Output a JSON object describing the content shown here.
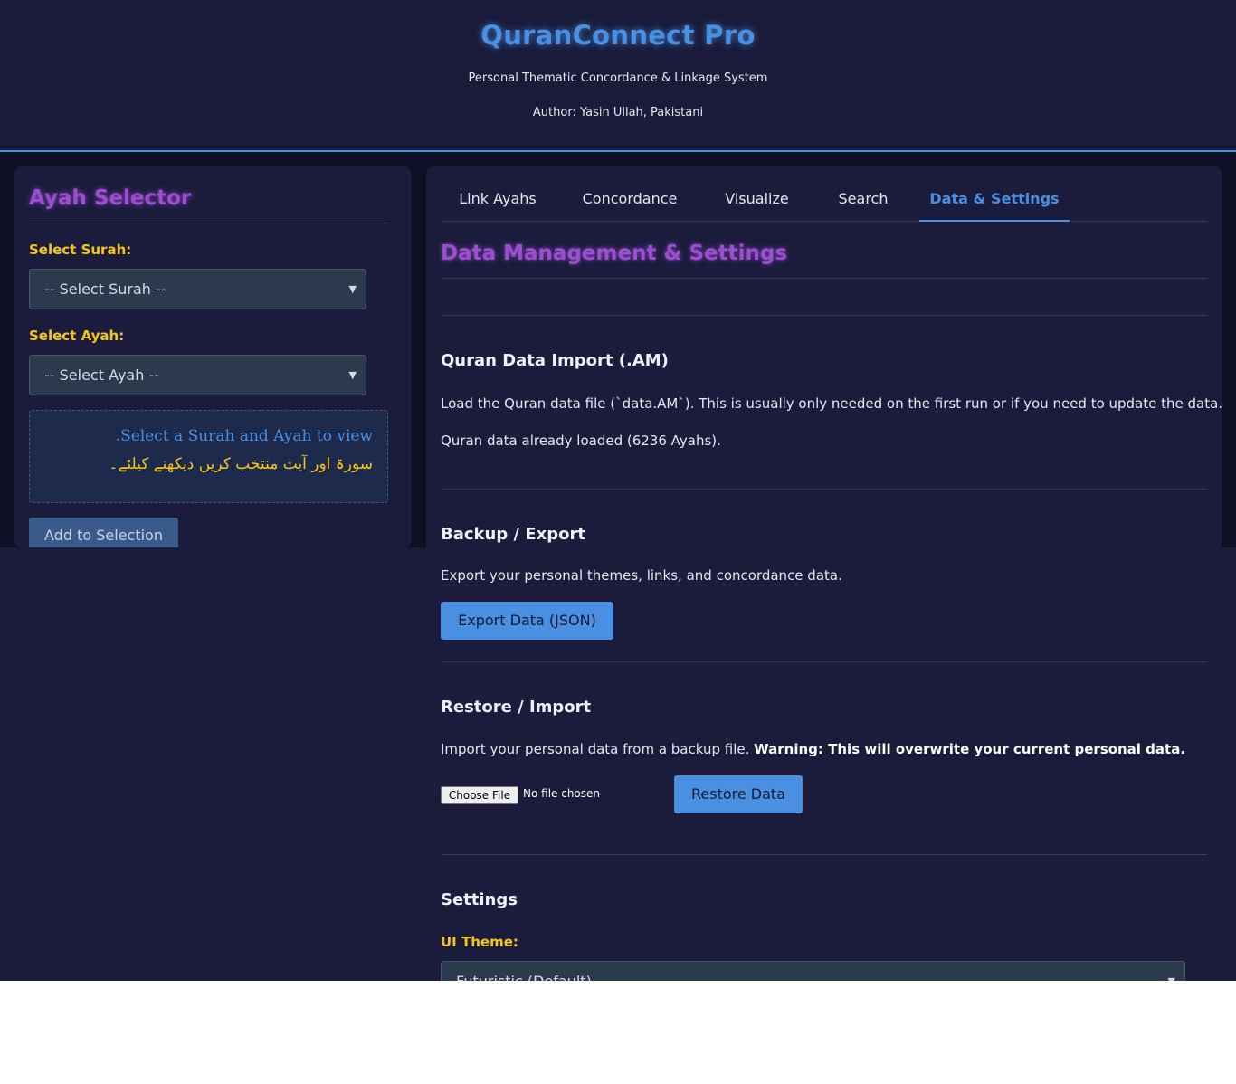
{
  "header": {
    "title": "QuranConnect Pro",
    "subtitle": "Personal Thematic Concordance & Linkage System",
    "author": "Author: Yasin Ullah, Pakistani"
  },
  "ayah_selector": {
    "heading": "Ayah Selector",
    "surah_label": "Select Surah:",
    "surah_selected": "-- Select Surah --",
    "ayah_label": "Select Ayah:",
    "ayah_selected": "-- Select Ayah --",
    "info_en": ".Select a Surah and Ayah to view",
    "info_ur": "سورۃ اور آیت منتخب کریں دیکھنے کیلئے۔",
    "add_button": "Add to Selection"
  },
  "tabs": [
    {
      "label": "Link Ayahs",
      "active": false
    },
    {
      "label": "Concordance",
      "active": false
    },
    {
      "label": "Visualize",
      "active": false
    },
    {
      "label": "Search",
      "active": false
    },
    {
      "label": "Data & Settings",
      "active": true
    }
  ],
  "main": {
    "heading": "Data Management & Settings",
    "import": {
      "title": "Quran Data Import (.AM)",
      "description": "Load the Quran data file (`data.AM`). This is usually only needed on the first run or if you need to update the data.",
      "status": "Quran data already loaded (6236 Ayahs)."
    },
    "backup": {
      "title": "Backup / Export",
      "description": "Export your personal themes, links, and concordance data.",
      "button": "Export Data (JSON)"
    },
    "restore": {
      "title": "Restore / Import",
      "description": "Import your personal data from a backup file. ",
      "warning": "Warning: This will overwrite your current personal data.",
      "file_button": "Choose File",
      "file_status": "No file chosen",
      "button": "Restore Data"
    },
    "settings": {
      "title": "Settings",
      "theme_label": "UI Theme:",
      "theme_selected": "Futuristic (Default)"
    }
  },
  "colors": {
    "background": "#1a1b3a",
    "panel": "#1b1c3c",
    "accent_blue": "#4a90e2",
    "accent_purple": "#9b4fd0",
    "label_gold": "#f5c518"
  }
}
